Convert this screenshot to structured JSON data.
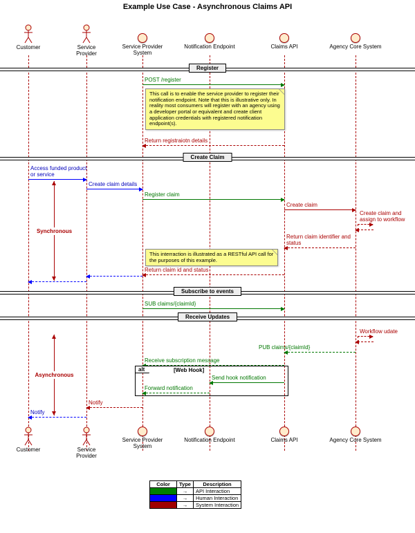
{
  "title": "Example Use Case - Asynchronous Claims API",
  "participants": {
    "customer": "Customer",
    "serviceProvider": "Service Provider",
    "spSystem": "Service Provider\nSystem",
    "notification": "Notification Endpoint",
    "claims": "Claims API",
    "agency": "Agency Core System"
  },
  "colX": {
    "customer": 41,
    "serviceProvider": 125,
    "spSystem": 206,
    "notification": 303,
    "claims": 411,
    "agency": 514
  },
  "dividers": {
    "register": "Register",
    "createClaim": "Create Claim",
    "subscribe": "Subscribe to events",
    "receiveUpdates": "Receive Updates"
  },
  "messages": {
    "postRegister": "POST /register",
    "returnReg": "Return registraiotn details",
    "accessFunded": "Access funded product\nor service",
    "createClaimDetails": "Create claim details",
    "registerClaim": "Register claim",
    "createClaim": "Create claim",
    "createAssign": "Create claim and\nassign to workflow",
    "returnIdStatus": "Return claim identifier and status",
    "returnIdStatus2": "Return claim id and status",
    "blank": " ",
    "subClaims": "SUB claims/{claimId}",
    "workflowUpdate": "Workflow udate",
    "pubClaims": "PUB claims/{claimId}",
    "receiveSub": "Receive subscription message",
    "sendHook": "Send hook notification",
    "forwardNotif": "Forward notification",
    "notify": "Notify",
    "notify2": "Notify"
  },
  "notes": {
    "note1": "This call is to enable the service provider to register their notification endpoint. Note that this is illustrative only. In reality most consumers will register with an agency using a developer portal or equivalent and create client application credentials with registered notification endpoint(s).",
    "note2": "This interraction is illustrated as a RESTful API call for the purposes of this example."
  },
  "spans": {
    "sync": "Synchronous",
    "async": "Asynchronous"
  },
  "alt": {
    "tag": "alt",
    "cond": "[Web Hook]"
  },
  "legend": {
    "headers": {
      "color": "Color",
      "type": "Type",
      "desc": "Description"
    },
    "rows": [
      {
        "color": "#008000",
        "glyph": "→",
        "desc": "API Interaction"
      },
      {
        "color": "#0000ff",
        "glyph": "→",
        "desc": "Human Interaction"
      },
      {
        "color": "#a00000",
        "glyph": "→",
        "desc": "System Interaction"
      }
    ]
  }
}
